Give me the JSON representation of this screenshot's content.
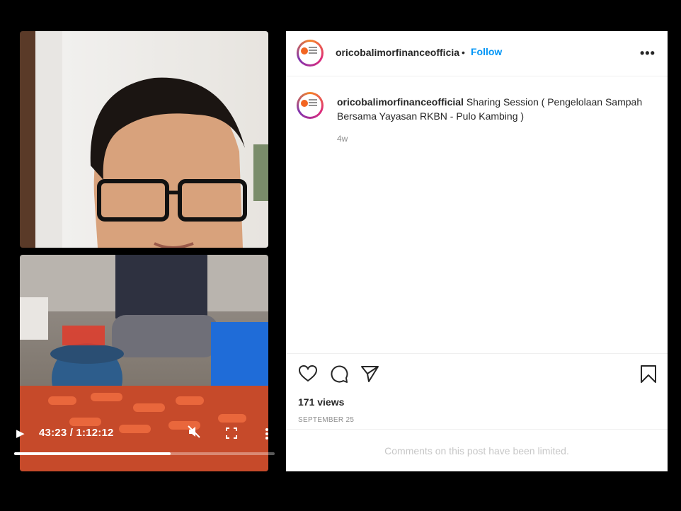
{
  "video": {
    "time_display": "43:23 / 1:12:12",
    "progress_fraction": 0.6
  },
  "post": {
    "username": "oricobalimorfinanceofficial",
    "separator": "•",
    "follow_label": "Follow",
    "caption": "Sharing Session ( Pengelolaan Sampah Bersama Yayasan RKBN - Pulo Kambing )",
    "age": "4w",
    "views": "171 views",
    "date": "SEPTEMBER 25",
    "comments_notice": "Comments on this post have been limited.",
    "avatar_text": "Orico Balimor Finance"
  },
  "icons": {
    "like": "heart-icon",
    "comment": "comment-icon",
    "share": "share-icon",
    "save": "bookmark-icon",
    "more": "more-icon"
  }
}
